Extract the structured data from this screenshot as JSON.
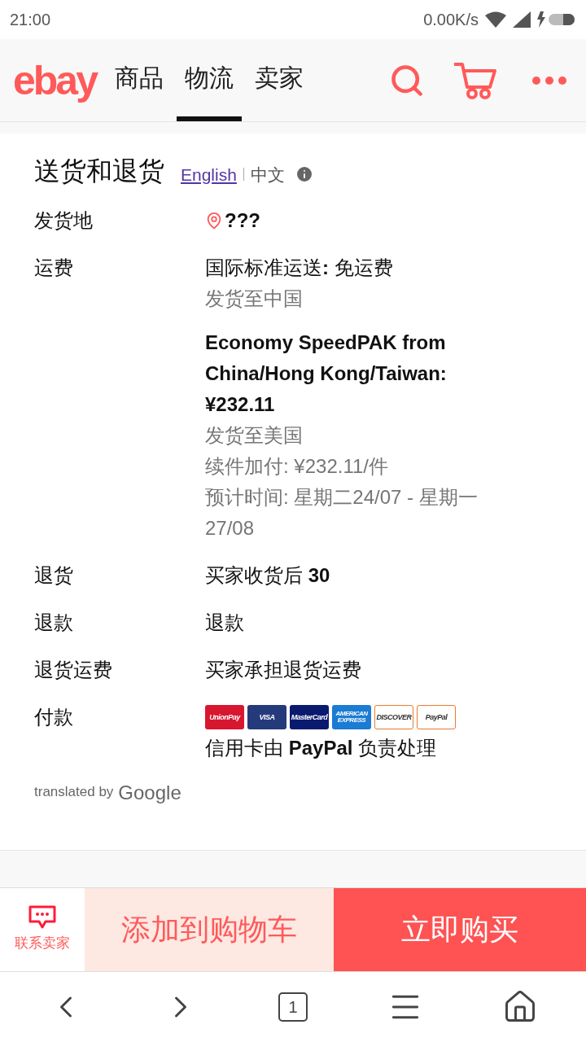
{
  "status_bar": {
    "time": "21:00",
    "speed": "0.00K/s"
  },
  "header": {
    "logo": "ebay",
    "tabs": [
      {
        "label": "商品",
        "selected": false
      },
      {
        "label": "物流",
        "selected": true
      },
      {
        "label": "卖家",
        "selected": false
      }
    ]
  },
  "section": {
    "title": "送货和退货",
    "languages": [
      {
        "label": "English",
        "selected": false
      },
      {
        "label": "中文",
        "selected": true
      }
    ],
    "rows": [
      {
        "label": "发货地",
        "kind": "location",
        "lines": [
          {
            "text": "???",
            "kind": "bold"
          }
        ]
      },
      {
        "label": "运费",
        "kind": "text",
        "lines": [
          {
            "text": "国际标准运送**:** 免运费",
            "kind": "normal"
          },
          {
            "text": "发货至中国",
            "kind": "muted"
          },
          {
            "text": "Economy SpeedPAK from China/Hong Kong/Taiwan: ¥232.11",
            "kind": "bold"
          },
          {
            "text": "发货至美国",
            "kind": "muted"
          },
          {
            "text": "续件加付: ¥232.11/件",
            "kind": "muted"
          },
          {
            "text": "预计时间: 星期二24/07 - 星期一27/08",
            "kind": "muted"
          }
        ]
      },
      {
        "label": "退货",
        "kind": "text",
        "lines": [
          {
            "text": "买家收货后 **30**",
            "kind": "normal"
          }
        ]
      },
      {
        "label": "退款",
        "kind": "text",
        "lines": [
          {
            "text": "退款",
            "kind": "normal"
          }
        ]
      },
      {
        "label": "退货运费",
        "kind": "text",
        "lines": [
          {
            "text": "买家承担退货运费",
            "kind": "normal"
          }
        ]
      },
      {
        "label": "付款",
        "kind": "payment",
        "lines": [
          {
            "text": "信用卡由 **PayPal** 负责处理",
            "kind": "normal"
          }
        ]
      }
    ],
    "payment_methods": [
      {
        "label": "UnionPay",
        "color": "#d7172f"
      },
      {
        "label": "VISA",
        "color": "#253a7b"
      },
      {
        "label": "MasterCard",
        "color": "#0a1a6e"
      },
      {
        "label": "AMERICAN EXPRESS",
        "color": "#1c7bd3"
      },
      {
        "label": "DISCOVER",
        "color": "#ffffff"
      },
      {
        "label": "PayPal",
        "color": "#ffffff"
      }
    ],
    "attribution": {
      "prefix": "translated by",
      "brand": "Google"
    }
  },
  "action_bar": {
    "contact": "联系卖家",
    "add_to_cart": "添加到购物车",
    "buy_now": "立即购买"
  },
  "browser_nav": {
    "tab_count": "1"
  }
}
